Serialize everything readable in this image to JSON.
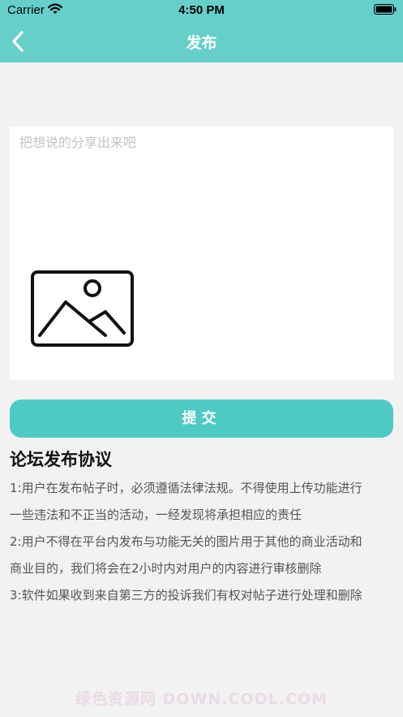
{
  "status_bar": {
    "carrier": "Carrier",
    "time": "4:50 PM"
  },
  "nav": {
    "title": "发布",
    "back_icon": "chevron-left-icon"
  },
  "compose": {
    "placeholder": "把想说的分享出来吧",
    "value": "",
    "image_icon": "image-placeholder-icon"
  },
  "submit_label": "提交",
  "agreement": {
    "title": "论坛发布协议",
    "lines": [
      "1:用户在发布帖子时，必须遵循法律法规。不得使用上传功能进行",
      "一些违法和不正当的活动，一经发现将承担相应的责任",
      "2:用户不得在平台内发布与功能无关的图片用于其他的商业活动和",
      "商业目的，我们将会在2小时内对用户的内容进行审核删除",
      "3:软件如果收到来自第三方的投诉我们有权对帖子进行处理和删除"
    ]
  },
  "watermark": "绿色资源网 DOWN.COOL.COM",
  "colors": {
    "header": "#66cfca",
    "submit": "#4ecac4",
    "background": "#f2f2f2"
  }
}
